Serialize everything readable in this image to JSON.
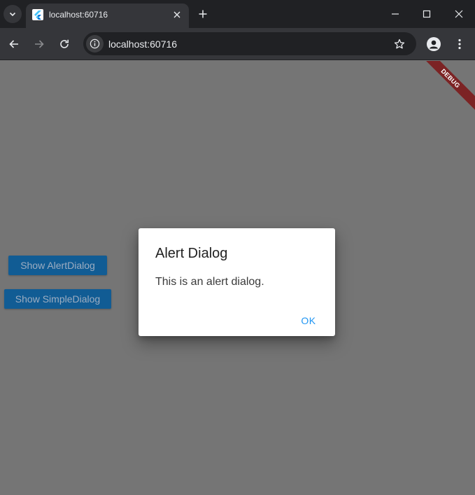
{
  "browser": {
    "tab": {
      "title": "localhost:60716"
    },
    "address_bar": {
      "url": "localhost:60716"
    },
    "icons": {
      "tab_search": "chevron-down-icon",
      "favicon": "flutter-icon",
      "tab_close": "close-icon",
      "new_tab": "plus-icon",
      "minimize": "minimize-icon",
      "maximize": "maximize-icon",
      "window_close": "close-icon",
      "back": "arrow-left-icon",
      "forward": "arrow-right-icon",
      "reload": "reload-icon",
      "site_info": "info-icon",
      "bookmark": "star-icon",
      "profile": "profile-icon",
      "menu": "more-vert-icon"
    }
  },
  "app": {
    "debug_banner": "DEBUG",
    "buttons": {
      "show_alert": "Show AlertDialog",
      "show_simple": "Show SimpleDialog"
    },
    "dialog": {
      "title": "Alert Dialog",
      "content": "This is an alert dialog.",
      "ok_label": "OK"
    }
  },
  "colors": {
    "scrim": "#757575",
    "button_bg": "#115c94",
    "accent": "#2196f3",
    "debug_banner": "#7c2324"
  }
}
